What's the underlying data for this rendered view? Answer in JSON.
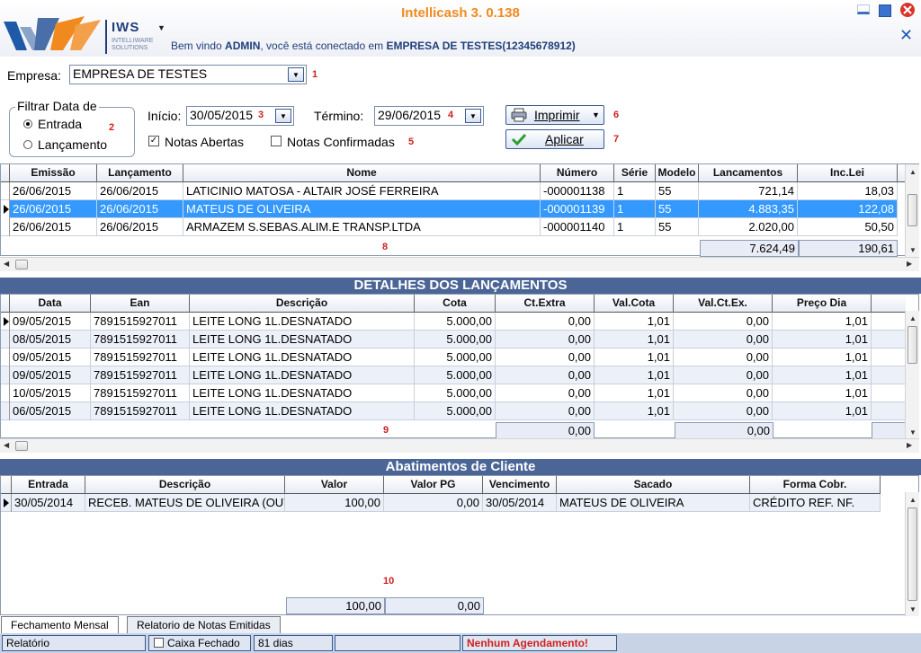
{
  "header": {
    "app_title": "Intellicash 3. 0.138",
    "logo_text": "IWS",
    "logo_sub1": "INTELLIWARE",
    "logo_sub2": "SOLUTIONS",
    "welcome_prefix": "Bem vindo",
    "welcome_user": "ADMIN",
    "welcome_mid": ", você está conectado em",
    "welcome_company": "EMPRESA DE TESTES(12345678912)"
  },
  "form": {
    "empresa_label": "Empresa:",
    "empresa_value": "EMPRESA DE TESTES",
    "filtrar_label": "Filtrar Data de",
    "radio_entrada": "Entrada",
    "radio_lancamento": "Lançamento",
    "inicio_label": "Início:",
    "inicio_value": "30/05/2015",
    "termino_label": "Término:",
    "termino_value": "29/06/2015",
    "chk_abertas": "Notas Abertas",
    "chk_confirmadas": "Notas Confirmadas",
    "imprimir_label": "Imprimir",
    "aplicar_label": "Aplicar",
    "markers": [
      "1",
      "2",
      "3",
      "4",
      "5",
      "6",
      "7",
      "8",
      "9",
      "10"
    ]
  },
  "grid1": {
    "headers": [
      "Emissão",
      "Lançamento",
      "Nome",
      "Número",
      "Série",
      "Modelo",
      "Lancamentos",
      "Inc.Lei"
    ],
    "rows": [
      [
        "26/06/2015",
        "26/06/2015",
        "LATICINIO  MATOSA - ALTAIR JOSÉ FERREIRA",
        "-000001138",
        "1",
        "55",
        "721,14",
        "18,03"
      ],
      [
        "26/06/2015",
        "26/06/2015",
        "MATEUS DE OLIVEIRA",
        "-000001139",
        "1",
        "55",
        "4.883,35",
        "122,08"
      ],
      [
        "26/06/2015",
        "26/06/2015",
        "ARMAZEM S.SEBAS.ALIM.E TRANSP.LTDA",
        "-000001140",
        "1",
        "55",
        "2.020,00",
        "50,50"
      ]
    ],
    "total_lancamentos": "7.624,49",
    "total_inclei": "190,61"
  },
  "grid2": {
    "title": "DETALHES DOS LANÇAMENTOS",
    "headers": [
      "Data",
      "Ean",
      "Descrição",
      "Cota",
      "Ct.Extra",
      "Val.Cota",
      "Val.Ct.Ex.",
      "Preço Dia"
    ],
    "rows": [
      [
        "09/05/2015",
        "7891515927011",
        "LEITE LONG 1L.DESNATADO",
        "5.000,00",
        "0,00",
        "1,01",
        "0,00",
        "1,01"
      ],
      [
        "08/05/2015",
        "7891515927011",
        "LEITE LONG 1L.DESNATADO",
        "5.000,00",
        "0,00",
        "1,01",
        "0,00",
        "1,01"
      ],
      [
        "09/05/2015",
        "7891515927011",
        "LEITE LONG 1L.DESNATADO",
        "5.000,00",
        "0,00",
        "1,01",
        "0,00",
        "1,01"
      ],
      [
        "09/05/2015",
        "7891515927011",
        "LEITE LONG 1L.DESNATADO",
        "5.000,00",
        "0,00",
        "1,01",
        "0,00",
        "1,01"
      ],
      [
        "10/05/2015",
        "7891515927011",
        "LEITE LONG 1L.DESNATADO",
        "5.000,00",
        "0,00",
        "1,01",
        "0,00",
        "1,01"
      ],
      [
        "06/05/2015",
        "7891515927011",
        "LEITE LONG 1L.DESNATADO",
        "5.000,00",
        "0,00",
        "1,01",
        "0,00",
        "1,01"
      ]
    ],
    "total_ctextra": "0,00",
    "total_valctex": "0,00"
  },
  "grid3": {
    "title": "Abatimentos de Cliente",
    "headers": [
      "Entrada",
      "Descrição",
      "Valor",
      "Valor PG",
      "Vencimento",
      "Sacado",
      "Forma Cobr."
    ],
    "rows": [
      [
        "30/05/2014",
        "RECEB. MATEUS DE OLIVEIRA (OUT",
        "100,00",
        "0,00",
        "30/05/2014",
        "MATEUS DE OLIVEIRA",
        "CRÉDITO REF. NF."
      ]
    ],
    "total_valor": "100,00",
    "total_valorpg": "0,00"
  },
  "tabs": [
    "Fechamento Mensal",
    "Relatorio de Notas Emitidas"
  ],
  "status": {
    "relatorio": "Relatório",
    "caixa": "Caixa Fechado",
    "dias": "81 dias",
    "empty": "",
    "agendamento": "Nenhum Agendamento!"
  },
  "colors": {
    "accent_orange": "#f08a1e",
    "brand_blue": "#1f3f7a",
    "section_bar": "#4b6596",
    "selection": "#3399ff",
    "alert_red": "#d02020"
  }
}
